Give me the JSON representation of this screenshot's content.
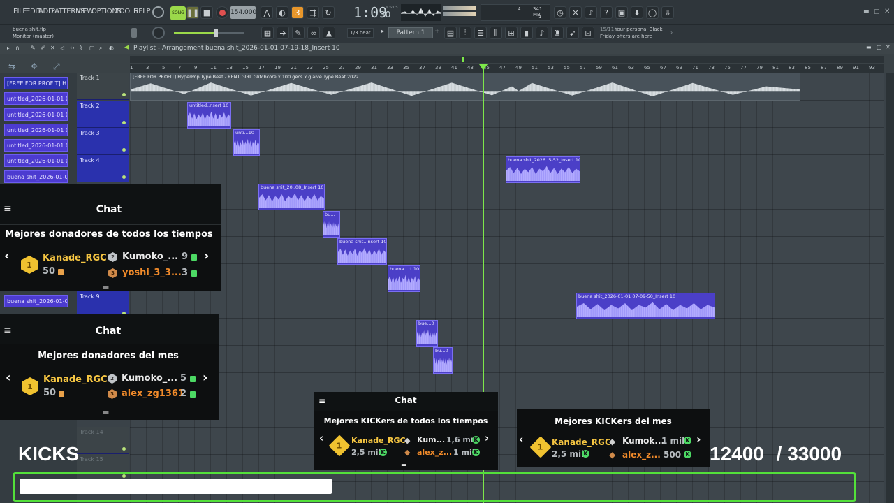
{
  "menubar": {
    "items": [
      "FILE",
      "EDIT",
      "ADD",
      "PATTERNS",
      "VIEW",
      "OPTIONS",
      "TOOLS",
      "HELP"
    ],
    "song_label": "SONG",
    "tempo": "154.000",
    "time": "1:09",
    "time_sub": "30",
    "time_label": "M:S:CS",
    "cpu_top": "4",
    "cpu_bottom": "1",
    "ram": "341 MB"
  },
  "infobar": {
    "project": "buena shit.flp",
    "monitor": "Monitor (master)",
    "snap": "1/3 beat",
    "pattern": "Pattern 1",
    "news_date": "15/11",
    "news_text_line1": "Your personal Black",
    "news_text_line2": "Friday offers are here"
  },
  "playlist": {
    "title": "Playlist - Arrangement",
    "breadcrumb": "buena shit_2026-01-01 07-19-18_Insert 10",
    "ruler": [
      "1",
      "3",
      "5",
      "7",
      "9",
      "11",
      "13",
      "15",
      "17",
      "19",
      "21",
      "23",
      "25",
      "27",
      "29",
      "31",
      "33",
      "35",
      "37",
      "39",
      "41",
      "43",
      "45",
      "47",
      "49",
      "51",
      "53",
      "55",
      "57",
      "59",
      "61",
      "63",
      "65",
      "67",
      "69",
      "71",
      "73",
      "75",
      "77",
      "79",
      "81",
      "83",
      "85",
      "87",
      "89",
      "91",
      "93"
    ]
  },
  "browser": {
    "items": [
      "[FREE FOR PROFIT] H...",
      "untitled_2026-01-01 06-...",
      "untitled_2026-01-01 06-...",
      "untitled_2026-01-01 06-...",
      "untitled_2026-01-01 06-...",
      "untitled_2026-01-01 06-...",
      "buena shit_2026-01-01...",
      "buena shit_2026-01-01..."
    ]
  },
  "tracks": {
    "t1": "Track 1",
    "t2": "Track 2",
    "t3": "Track 3",
    "t4": "Track 4",
    "t9": "Track 9",
    "t14": "Track 14",
    "t15": "Track 15"
  },
  "clips": {
    "audio_main": "[FREE FOR PROFIT] HyperPop Type Beat - RENT GIRL  Glitchcore x 100 gecs x glaive Type Beat 2022",
    "c1": "untitled..nsert 10",
    "c2": "unti...10",
    "c3": "buena shit_2026..5-52_Insert 10",
    "c4": "buena shit_20..08_Insert 10",
    "c5": "bu...",
    "c6": "buena shit...nsert 10",
    "c7": "buena...rt 10",
    "c8": "buena shit_2026-01-01 07-09-50_Insert 10",
    "c9": "bue...0",
    "c10": "bu...0"
  },
  "widget1": {
    "chat": "Chat",
    "title": "Mejores donadores de todos los tiempos",
    "first_name": "Kanade_RGC",
    "first_val": "50",
    "second_name": "Kumoko_...",
    "second_val": "9",
    "third_name": "yoshi_3_3...",
    "third_val": "3"
  },
  "widget2": {
    "chat": "Chat",
    "title": "Mejores donadores del mes",
    "first_name": "Kanade_RGC",
    "first_val": "50",
    "second_name": "Kumoko_...",
    "second_val": "5",
    "third_name": "alex_zg1361",
    "third_val": "2"
  },
  "widget3": {
    "chat": "Chat",
    "title": "Mejores KICKers de todos los tiempos",
    "first_name": "Kanade_RGC",
    "first_val": "2,5 mil",
    "second_name": "Kum...",
    "second_val": "1,6 mil",
    "third_name": "alex_z...",
    "third_val": "1 mil"
  },
  "widget4": {
    "title": "Mejores KICKers del mes",
    "first_name": "Kanade_RGC",
    "first_val": "2,5 mil",
    "second_name": "Kumok...",
    "second_val": "1 mil",
    "third_name": "alex_z...",
    "third_val": "500"
  },
  "kicks_goal": {
    "label": "KICKS",
    "current": "12400",
    "target": "/ 33000",
    "progress": 0.376
  },
  "colors": {
    "accent_green": "#53e03a",
    "clip_purple": "#4b3fc7",
    "gold": "#f5c542"
  }
}
